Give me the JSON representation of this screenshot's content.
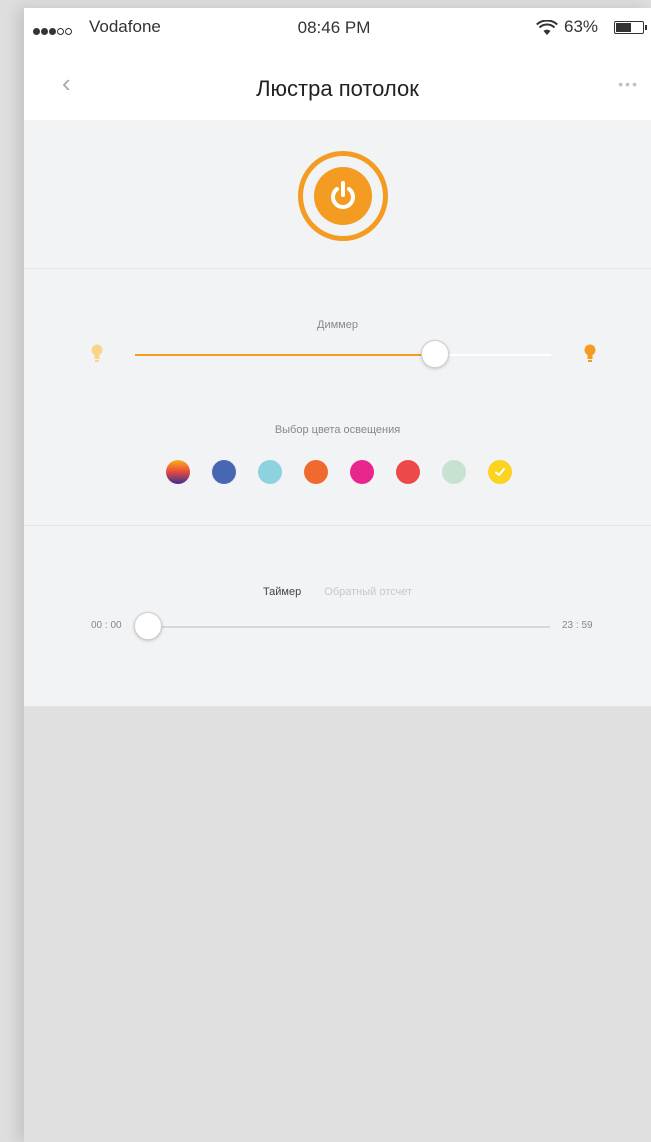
{
  "status_bar": {
    "carrier": "Vodafone",
    "time": "08:46 PM",
    "battery_percent": "63%",
    "battery_level": 0.63,
    "signal_bars_on": 3,
    "signal_bars_total": 5
  },
  "nav": {
    "title": "Люстра потолок",
    "back_icon": "chevron-left-icon",
    "more_icon": "more-dots-icon"
  },
  "power": {
    "icon": "power-icon",
    "state": "on",
    "color": "#f39c21"
  },
  "dimmer": {
    "label": "Диммер",
    "value": 0.72,
    "accent": "#f39c21"
  },
  "color_picker": {
    "label": "Выбор цвета освещения",
    "selected_index": 7,
    "swatches": [
      {
        "name": "gradient",
        "color": "linear-gradient(180deg,#f7b21c 0%,#ef4e3a 45%,#3b2e8f 100%)"
      },
      {
        "name": "blue",
        "color": "#4767b4"
      },
      {
        "name": "light-blue",
        "color": "#8cd3df"
      },
      {
        "name": "orange",
        "color": "#ef6a2c"
      },
      {
        "name": "pink",
        "color": "#e8268c"
      },
      {
        "name": "red",
        "color": "#ec4a4a"
      },
      {
        "name": "mint",
        "color": "#c6e3d2"
      },
      {
        "name": "yellow",
        "color": "#fcd31f"
      }
    ]
  },
  "timer": {
    "tabs": [
      {
        "label": "Таймер",
        "active": true
      },
      {
        "label": "Обратный отсчет",
        "active": false
      }
    ],
    "start_label": "00 : 00",
    "end_label": "23 : 59",
    "value": 0.0
  }
}
